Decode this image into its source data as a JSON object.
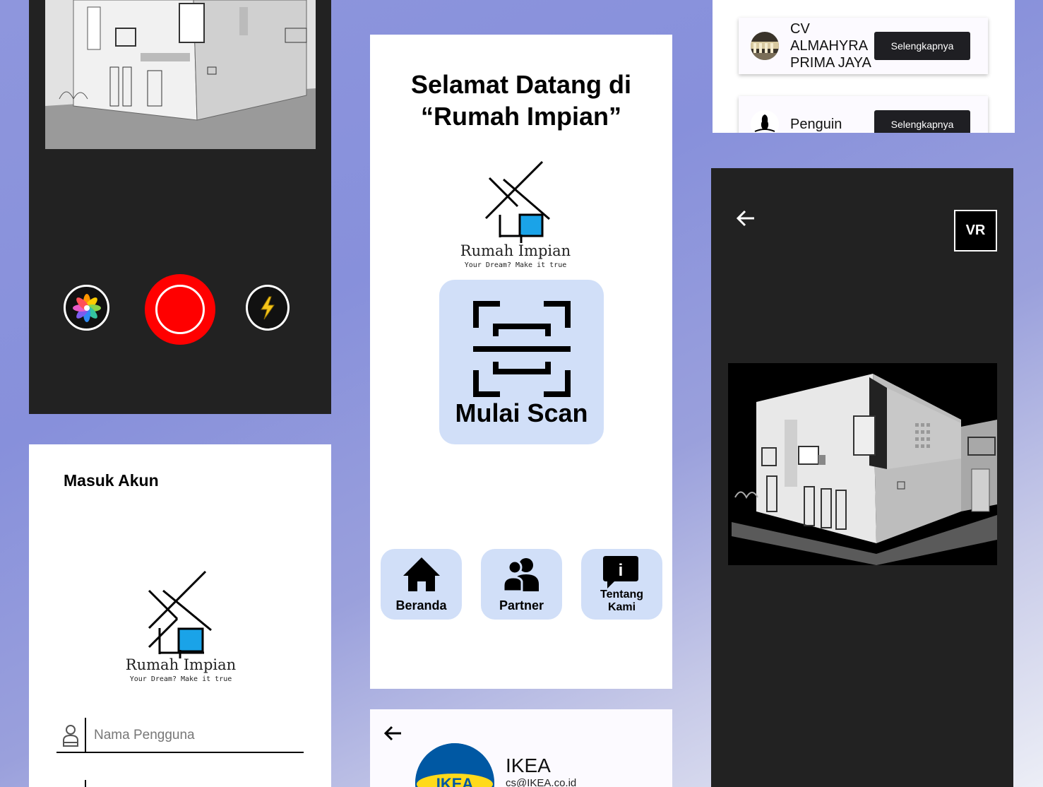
{
  "home": {
    "welcome_line1": "Selamat Datang di",
    "welcome_line2": "“Rumah Impian”",
    "logo_text": "Rumah Impian",
    "logo_tagline": "Your Dream? Make it true",
    "scan_label": "Mulai Scan",
    "nav": [
      {
        "label": "Beranda",
        "icon": "home-icon"
      },
      {
        "label": "Partner",
        "icon": "users-icon"
      },
      {
        "label_line1": "Tentang",
        "label_line2": "Kami",
        "icon": "info-icon"
      }
    ]
  },
  "login": {
    "title": "Masuk Akun",
    "logo_text": "Rumah Impian",
    "logo_tagline": "Your Dream? Make it true",
    "username_placeholder": "Nama Pengguna"
  },
  "camera": {
    "buttons": [
      "gallery-icon",
      "shutter-button",
      "flash-icon"
    ],
    "shutter_color": "#ff0000"
  },
  "partners": {
    "items": [
      {
        "name_line1": "CV",
        "name_line2": "ALMAHYRA",
        "name_line3": "PRIMA JAYA",
        "button": "Selengkapnya"
      },
      {
        "name": "Penguin",
        "button": "Selengkapnya"
      }
    ]
  },
  "vr": {
    "vr_label": "VR"
  },
  "detail": {
    "name": "IKEA",
    "email": "cs@IKEA.co.id",
    "logo_text": "IKEA"
  },
  "colors": {
    "accent_light": "#d1dff8",
    "dark_panel": "#222222",
    "logo_blue": "#1aa3e8",
    "button_dark": "#1f1f23"
  }
}
